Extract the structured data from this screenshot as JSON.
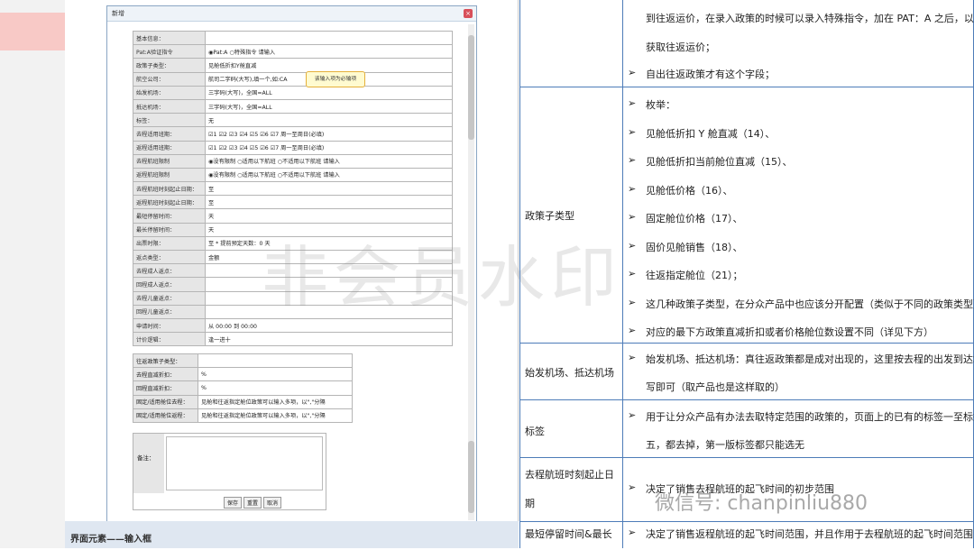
{
  "dialog": {
    "title": "新增",
    "tooltip": "该输入项为必输项",
    "watermark": "非会员水印",
    "rows": [
      {
        "label": "基本信息：",
        "value": ""
      },
      {
        "label": "Pat:A验证指令",
        "value": "◉Pat:A ○特殊指令     请输入"
      },
      {
        "label": "政策子类型：",
        "value": "见舱低折扣Y舱直减"
      },
      {
        "label": "航空公司：",
        "value": "航司二字码(大写),填一个,如:CA"
      },
      {
        "label": "始发机场：",
        "value": "三字码(大写)，全国=ALL"
      },
      {
        "label": "抵达机场：",
        "value": "三字码(大写)，全国=ALL"
      },
      {
        "label": "标签：",
        "value": "无"
      },
      {
        "label": "去程适用班期：",
        "value": "☑1 ☑2 ☑3 ☑4 ☑5 ☑6 ☑7  周一至周日(必填)"
      },
      {
        "label": "返程适用班期：",
        "value": "☑1 ☑2 ☑3 ☑4 ☑5 ☑6 ☑7  周一至周日(必填)"
      },
      {
        "label": "去程航班限制",
        "value": "◉没有限制 ○适用以下航班 ○不适用以下航班   请输入"
      },
      {
        "label": "返程航班限制",
        "value": "◉没有限制 ○适用以下航班 ○不适用以下航班   请输入"
      },
      {
        "label": "去程航班时刻起止日期：",
        "value": "至"
      },
      {
        "label": "返程航班时刻起止日期：",
        "value": "至"
      },
      {
        "label": "最短停留时间：",
        "value": "天"
      },
      {
        "label": "最长停留时间：",
        "value": "天"
      },
      {
        "label": "出票时限：",
        "value": "至   * 提前预定天数：0  天"
      },
      {
        "label": "返点类型：",
        "value": "金额"
      },
      {
        "label": "去程成人返点：",
        "value": ""
      },
      {
        "label": "回程成人返点：",
        "value": ""
      },
      {
        "label": "去程儿童返点：",
        "value": ""
      },
      {
        "label": "回程儿童返点：",
        "value": ""
      },
      {
        "label": "申请时间：",
        "value": "从 00:00    到 00:00"
      },
      {
        "label": "计价逻辑：",
        "value": "逢一进十"
      }
    ],
    "rows2": [
      {
        "label": "往返政策子类型：",
        "value": ""
      },
      {
        "label": "去程直减折扣：",
        "value": "%"
      },
      {
        "label": "回程直减折扣：",
        "value": "%"
      },
      {
        "label": "固定/适用舱位去程：",
        "value": "见舱和往返指定舱位政策可以输入多项，以\",\"分隔"
      },
      {
        "label": "固定/适用舱位返程：",
        "value": "见舱和往返指定舱位政策可以输入多项，以\",\"分隔"
      }
    ],
    "note_label": "备注：",
    "buttons": [
      "保存",
      "重置",
      "取消"
    ]
  },
  "caption": "界面元素——输入框",
  "right": {
    "cont_lines": [
      "到往返运价，在录入政策的时候可以录入特殊指令，加在 PAT：A 之后，以便",
      "获取往返运价；",
      "自出往返政策才有这个字段；"
    ],
    "sections": [
      {
        "label": "政策子类型",
        "items": [
          "枚举：",
          "见舱低折扣 Y 舱直减（14）、",
          "见舱低折扣当前舱位直减（15）、",
          "见舱低价格（16）、",
          "固定舱位价格（17）、",
          "固价见舱销售（18）、",
          "往返指定舱位（21）；",
          "这几种政策子类型，在分众产品中也应该分开配置（类似于不同的政策类型）；",
          "对应的最下方政策直减折扣或者价格舱位数设置不同（详见下方）"
        ]
      },
      {
        "label": "始发机场、抵达机场",
        "items": [
          "始发机场、抵达机场：真往返政策都是成对出现的，这里按去程的出发到达填",
          "写即可（取产品也是这样取的）"
        ]
      },
      {
        "label": "标签",
        "items": [
          "用于让分众产品有办法去取特定范围的政策的，页面上的已有的标签一至标签",
          "五，都去掉，第一版标签都只能选无"
        ]
      },
      {
        "label": "去程航班时刻起止日",
        "label2": "期",
        "items": [
          "决定了销售去程航班的起飞时间的初步范围"
        ]
      },
      {
        "label": "最短停留时间&最长",
        "items": [
          "决定了销售返程航班的起飞时间范围，并且作用于去程航班的起飞时间范围"
        ]
      }
    ],
    "wechat_watermark": "微信号: chanpinliu880"
  }
}
